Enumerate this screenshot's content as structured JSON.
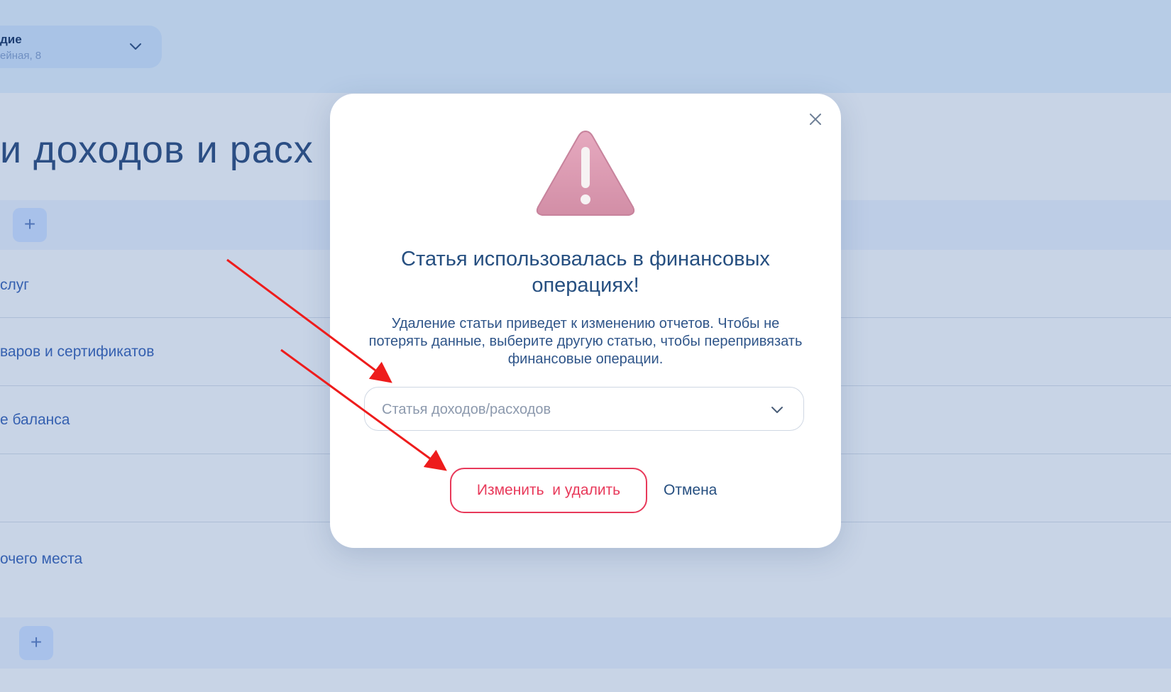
{
  "header": {
    "salon_name": "дие",
    "salon_address": "ейная, 8"
  },
  "page": {
    "title": "и доходов и расх",
    "add_label": "+",
    "rows": [
      {
        "label": "слуг"
      },
      {
        "label": "варов и сертификатов"
      },
      {
        "label": "е баланса"
      },
      {
        "label": ""
      },
      {
        "label": "очего места"
      }
    ]
  },
  "modal": {
    "title": "Статья использовалась в финансовых операциях!",
    "description": "Удаление статьи приведет к изменению отчетов. Чтобы не потерять данные, выберите другую статью, чтобы перепривязать финансовые операции.",
    "select_placeholder": "Статья доходов/расходов",
    "confirm_label": "Изменить  и удалить",
    "cancel_label": "Отмена"
  },
  "icons": {
    "close": "close-icon",
    "warning": "warning-triangle-icon",
    "chevron": "chevron-down-icon",
    "plus": "plus-icon"
  },
  "colors": {
    "overlay": "#c8d4e6",
    "accent_red": "#e8395a",
    "text_primary": "#264f80",
    "warning_pink": "#d99ab0",
    "annotation_arrow": "#ee1c1c"
  }
}
